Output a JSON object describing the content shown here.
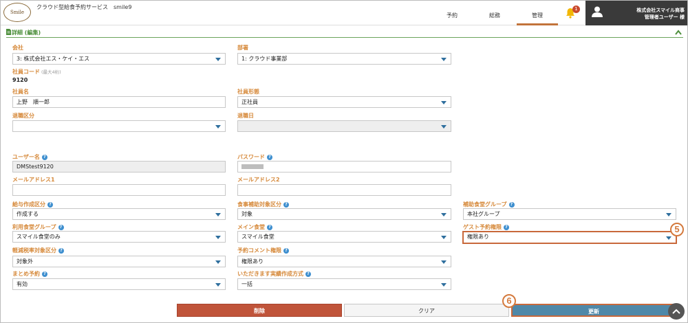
{
  "header": {
    "logo_text": "Smile",
    "app_title": "クラウド型給食予約サービス　smile9",
    "nav": [
      "予約",
      "総務",
      "管理"
    ],
    "active_nav": "管理",
    "bell_badge": "1",
    "user_company": "株式会社スマイル商事",
    "user_name": "管理者ユーザー 様"
  },
  "section": {
    "title": "詳細 (編集)"
  },
  "form": {
    "company": {
      "label": "会社",
      "value": "3: 株式会社エス・ケイ・エス"
    },
    "department": {
      "label": "部署",
      "value": "1: クラウド事業部"
    },
    "employee_code": {
      "label": "社員コード",
      "hint": "(最大4桁)",
      "value": "9120"
    },
    "employee_name": {
      "label": "社員名",
      "value": "上野　順一郎"
    },
    "employment_type": {
      "label": "社員形態",
      "value": "正社員"
    },
    "retirement_class": {
      "label": "退職区分",
      "value": ""
    },
    "retirement_date": {
      "label": "退職日",
      "value": ""
    },
    "username": {
      "label": "ユーザー名",
      "value": "DMStest9120"
    },
    "password": {
      "label": "パスワード",
      "value": ""
    },
    "email1": {
      "label": "メールアドレス1",
      "value": ""
    },
    "email2": {
      "label": "メールアドレス2",
      "value": ""
    },
    "payroll_class": {
      "label": "給与作成区分",
      "value": "作成する"
    },
    "meal_subsidy": {
      "label": "食事補助対象区分",
      "value": "対象"
    },
    "subsidy_group": {
      "label": "補助食堂グループ",
      "value": "本社グループ"
    },
    "cafeteria_group": {
      "label": "利用食堂グループ",
      "value": "スマイル食堂のみ"
    },
    "main_cafeteria": {
      "label": "メイン食堂",
      "value": "スマイル食堂"
    },
    "guest_permission": {
      "label": "ゲスト予約権限",
      "value": "権限あり"
    },
    "reduced_tax": {
      "label": "軽減税率対象区分",
      "value": "対象外"
    },
    "comment_permission": {
      "label": "予約コメント権限",
      "value": "権限あり"
    },
    "bulk_reservation": {
      "label": "まとめ予約",
      "value": "有効"
    },
    "itadakimasu": {
      "label": "いただきます実績作成方式",
      "value": "一括"
    }
  },
  "callouts": {
    "guest": "5",
    "update": "6"
  },
  "buttons": {
    "delete": "削除",
    "clear": "クリア",
    "update": "更新"
  },
  "colors": {
    "label": "#d6893a",
    "accent": "#c8683a",
    "delete": "#c0543a",
    "update": "#4f88a8",
    "section": "#4d8f3c"
  }
}
